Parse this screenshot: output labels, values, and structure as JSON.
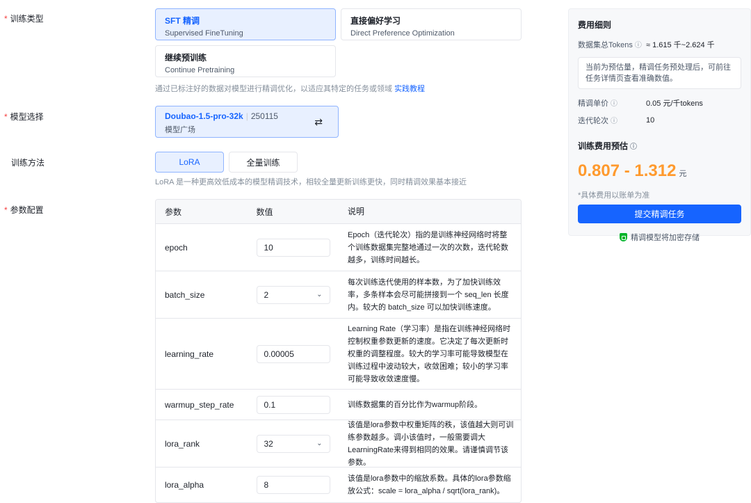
{
  "labels": {
    "training_type": "训练类型",
    "model_select": "模型选择",
    "training_method": "训练方法",
    "param_config": "参数配置",
    "required_mark": "*"
  },
  "training_types": [
    {
      "title": "SFT 精调",
      "subtitle": "Supervised FineTuning",
      "selected": true
    },
    {
      "title": "直接偏好学习",
      "subtitle": "Direct Preference Optimization",
      "selected": false
    },
    {
      "title": "继续预训练",
      "subtitle": "Continue Pretraining",
      "selected": false
    }
  ],
  "type_help": {
    "text": "通过已标注好的数据对模型进行精调优化，以适应其特定的任务或领域",
    "link": "实践教程"
  },
  "model": {
    "name": "Doubao-1.5-pro-32k",
    "version": "250115",
    "source": "模型广场",
    "swap_icon": "⇄"
  },
  "methods": [
    {
      "label": "LoRA",
      "selected": true
    },
    {
      "label": "全量训练",
      "selected": false
    }
  ],
  "method_help": "LoRA 是一种更高效低成本的模型精调技术，相较全量更新训练更快，同时精调效果基本接近",
  "table": {
    "headers": [
      "参数",
      "数值",
      "说明"
    ],
    "rows": [
      {
        "name": "epoch",
        "value": "10",
        "dropdown": false,
        "desc": "Epoch（迭代轮次）指的是训练神经网络时将整个训练数据集完整地通过一次的次数，迭代轮数越多，训练时间越长。"
      },
      {
        "name": "batch_size",
        "value": "2",
        "dropdown": true,
        "desc": "每次训练迭代使用的样本数，为了加快训练效率，多条样本会尽可能拼接到一个 seq_len 长度内。较大的 batch_size 可以加快训练速度。"
      },
      {
        "name": "learning_rate",
        "value": "0.00005",
        "dropdown": false,
        "desc": "Learning Rate（学习率）是指在训练神经网络时控制权重参数更新的速度。它决定了每次更新时权重的调整程度。较大的学习率可能导致模型在训练过程中波动较大，收敛困难；较小的学习率可能导致收敛速度慢。"
      },
      {
        "name": "warmup_step_rate",
        "value": "0.1",
        "dropdown": false,
        "desc": "训练数据集的百分比作为warmup阶段。"
      },
      {
        "name": "lora_rank",
        "value": "32",
        "dropdown": true,
        "desc": "该值是lora参数中权重矩阵的秩，该值越大则可训练参数越多。调小该值时，一般需要调大LearningRate来得到相同的效果。请谨慎调节该参数。"
      },
      {
        "name": "lora_alpha",
        "value": "8",
        "dropdown": false,
        "desc": "该值是lora参数中的缩放系数。具体的lora参数缩放公式：scale = lora_alpha / sqrt(lora_rank)。"
      }
    ]
  },
  "cost": {
    "title": "费用细则",
    "tokens_label": "数据集总Tokens",
    "tokens_value": "≈ 1.615 千~2.624 千",
    "note": "当前为预估量，精调任务预处理后，可前往任务详情页查看准确数值。",
    "unit_price_label": "精调单价",
    "unit_price_value": "0.05 元/千tokens",
    "epochs_label": "迭代轮次",
    "epochs_value": "10",
    "estimate_title": "训练费用预估",
    "estimate_value": "0.807 - 1.312",
    "estimate_unit": "元",
    "estimate_note": "*具体费用以账单为准",
    "submit_label": "提交精调任务",
    "secure_text": "精调模型将加密存储",
    "info_icon": "ⓘ"
  },
  "colors": {
    "primary": "#1664ff",
    "accent_orange": "#ff9a2e",
    "required": "#f53f3f",
    "secure_green": "#00b42a"
  }
}
